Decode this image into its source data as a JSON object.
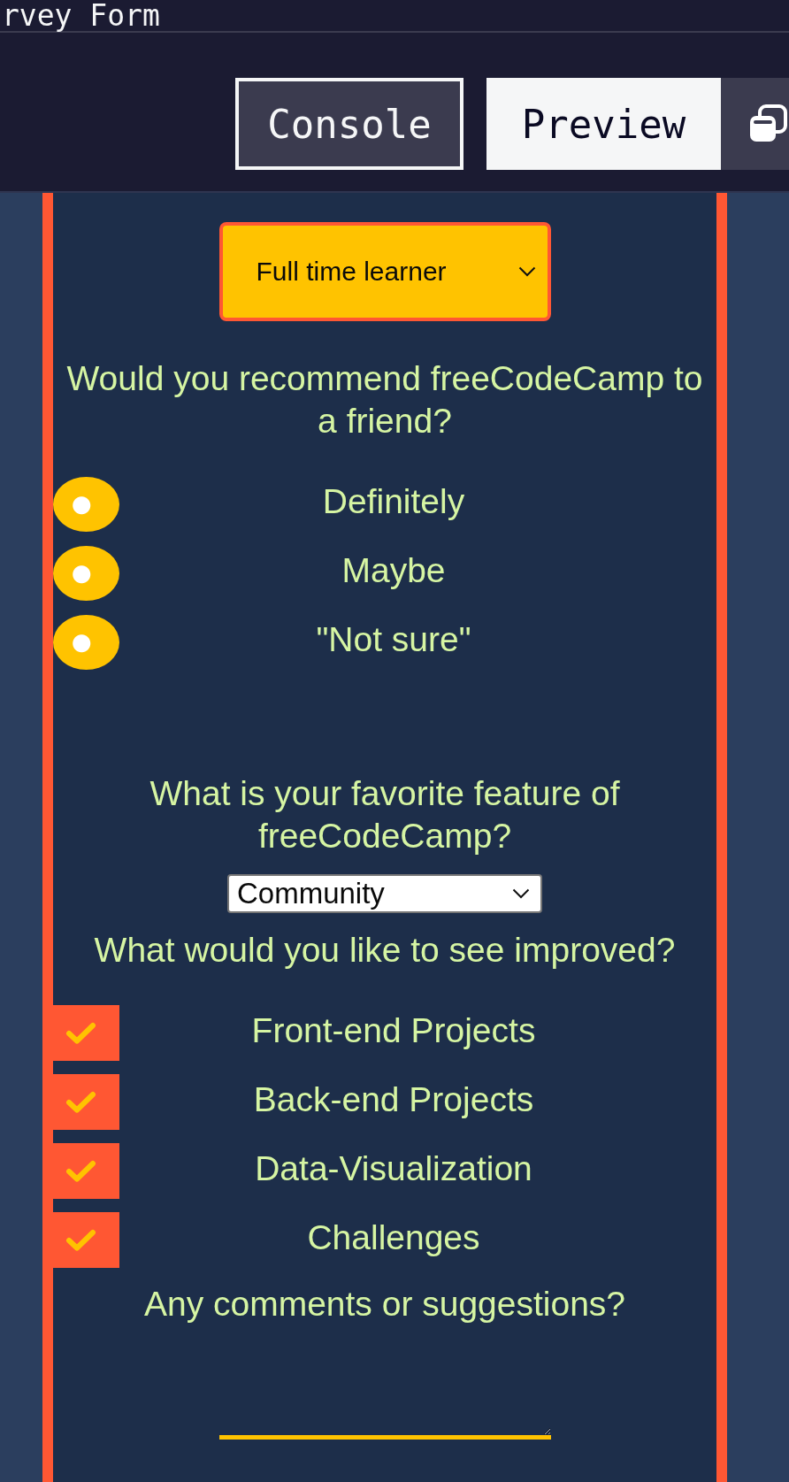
{
  "header": {
    "title": "rvey Form",
    "tabs": [
      {
        "label": "Console",
        "selected": false
      },
      {
        "label": "Preview",
        "selected": true
      }
    ]
  },
  "form": {
    "role_select": {
      "value": "Full time learner"
    },
    "recommend": {
      "question": "Would you recommend freeCodeCamp to a friend?",
      "options": [
        {
          "label": "Definitely",
          "selected": true
        },
        {
          "label": "Maybe",
          "selected": true
        },
        {
          "label": "\"Not sure\"",
          "selected": true
        }
      ]
    },
    "feature": {
      "question": "What is your favorite feature of freeCodeCamp?",
      "select": {
        "value": "Community"
      }
    },
    "improve": {
      "question": "What would you like to see improved?",
      "options": [
        {
          "label": "Front-end Projects",
          "checked": true
        },
        {
          "label": "Back-end Projects",
          "checked": true
        },
        {
          "label": "Data-Visualization",
          "checked": true
        },
        {
          "label": "Challenges",
          "checked": true
        }
      ]
    },
    "comments": {
      "question": "Any comments or suggestions?"
    }
  }
}
